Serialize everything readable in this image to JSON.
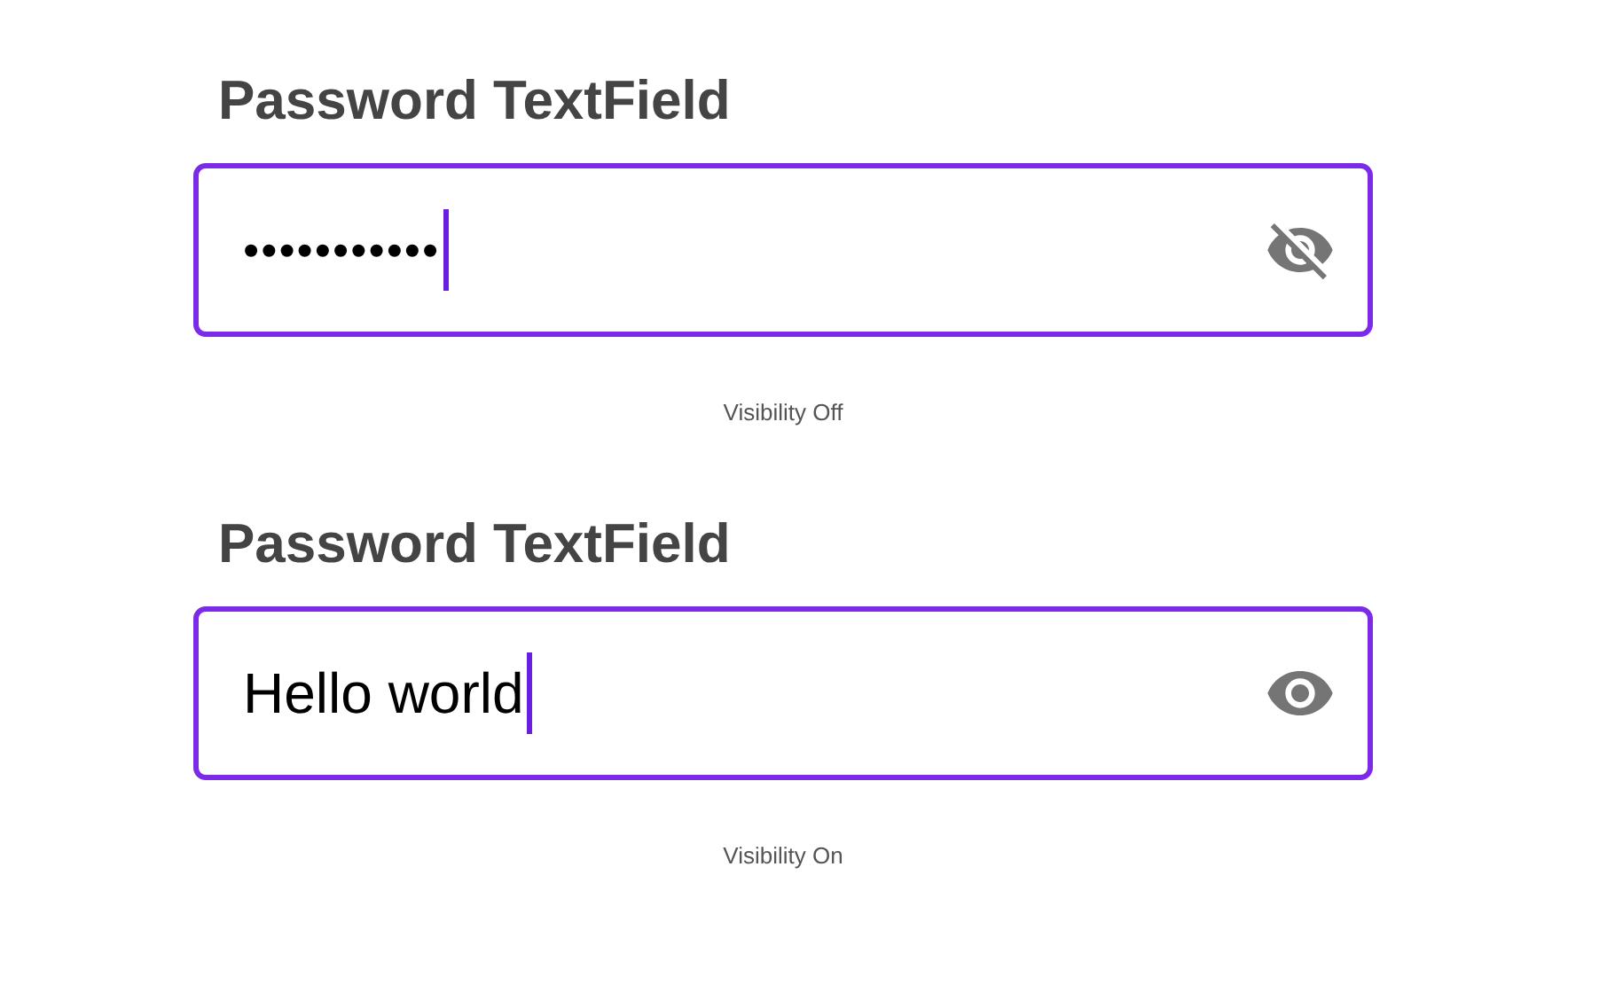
{
  "sections": [
    {
      "label": "Password TextField",
      "value": "•••••••••••",
      "visible": false,
      "caption": "Visibility Off"
    },
    {
      "label": "Password TextField",
      "value": "Hello world",
      "visible": true,
      "caption": "Visibility On"
    }
  ]
}
